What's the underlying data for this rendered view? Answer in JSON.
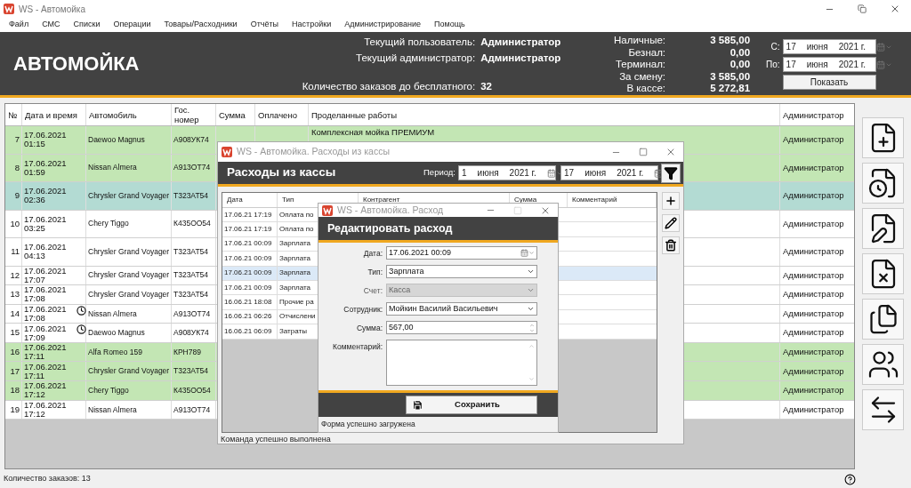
{
  "window": {
    "title": "WS - Автомойка"
  },
  "menu": [
    "Файл",
    "СМС",
    "Списки",
    "Операции",
    "Товары/Расходники",
    "Отчёты",
    "Настройки",
    "Администрирование",
    "Помощь"
  ],
  "header": {
    "title": "АВТОМОЙКА",
    "info": [
      {
        "label": "Текущий пользователь:",
        "value": "Администратор"
      },
      {
        "label": "Текущий администратор:",
        "value": "Администратор"
      },
      {
        "label": "Количество заказов до бесплатного:",
        "value": "32"
      }
    ],
    "totals": [
      {
        "label": "Наличные:",
        "value": "3 585,00"
      },
      {
        "label": "Безнал:",
        "value": "0,00"
      },
      {
        "label": "Терминал:",
        "value": "0,00"
      },
      {
        "label": "За смену:",
        "value": "3 585,00"
      },
      {
        "label": "В кассе:",
        "value": "5 272,81"
      }
    ],
    "date_from": {
      "label": "С:",
      "day": "17",
      "month": "июня",
      "year": "2021 г."
    },
    "date_to": {
      "label": "По:",
      "day": "17",
      "month": "июня",
      "year": "2021 г."
    },
    "show_button": "Показать"
  },
  "orders_table": {
    "columns": [
      "№",
      "Дата и время",
      "Автомобиль",
      "Гос. номер",
      "Сумма",
      "Оплачено",
      "Проделанные работы",
      "Администратор"
    ],
    "rows": [
      {
        "num": "7",
        "date": "17.06.2021",
        "time": "01:15",
        "car": "Daewoo Magnus",
        "plate": "А908УК74",
        "works": "Комплексная мойка ПРЕМИУМ",
        "admin": "Администратор",
        "color": "#c3e6b4",
        "clock": false
      },
      {
        "num": "8",
        "date": "17.06.2021",
        "time": "01:59",
        "car": "Nissan Almera",
        "plate": "А913ОТ74",
        "admin": "Администратор",
        "color": "#c3e6b4",
        "clock": false
      },
      {
        "num": "9",
        "date": "17.06.2021",
        "time": "02:36",
        "car": "Chrysler Grand Voyager",
        "plate": "Т323АТ54",
        "admin": "Администратор",
        "color": "#b3dbd3",
        "clock": false
      },
      {
        "num": "10",
        "date": "17.06.2021",
        "time": "03:25",
        "car": "Chery Tiggo",
        "plate": "К435ОО54",
        "admin": "Администратор",
        "color": "#ffffff",
        "clock": false
      },
      {
        "num": "11",
        "date": "17.06.2021",
        "time": "04:13",
        "car": "Chrysler Grand Voyager",
        "plate": "Т323АТ54",
        "admin": "Администратор",
        "color": "#ffffff",
        "clock": false
      },
      {
        "num": "12",
        "date": "17.06.2021",
        "time": "17:07",
        "car": "Chrysler Grand Voyager",
        "plate": "Т323АТ54",
        "admin": "Администратор",
        "color": "#ffffff",
        "clock": false
      },
      {
        "num": "13",
        "date": "17.06.2021",
        "time": "17:08",
        "car": "Chrysler Grand Voyager",
        "plate": "Т323АТ54",
        "admin": "Администратор",
        "color": "#ffffff",
        "clock": false
      },
      {
        "num": "14",
        "date": "17.06.2021",
        "time": "17:08",
        "car": "Nissan Almera",
        "plate": "А913ОТ74",
        "admin": "Администратор",
        "color": "#ffffff",
        "clock": true
      },
      {
        "num": "15",
        "date": "17.06.2021",
        "time": "17:09",
        "car": "Daewoo Magnus",
        "plate": "А908УК74",
        "admin": "Администратор",
        "color": "#ffffff",
        "clock": true
      },
      {
        "num": "16",
        "date": "17.06.2021",
        "time": "17:11",
        "car": "Alfa Romeo 159",
        "plate": "КРН789",
        "admin": "Администратор",
        "color": "#c3e6b4",
        "clock": false
      },
      {
        "num": "17",
        "date": "17.06.2021",
        "time": "17:11",
        "car": "Chrysler Grand Voyager",
        "plate": "Т323АТ54",
        "admin": "Администратор",
        "color": "#c3e6b4",
        "clock": false
      },
      {
        "num": "18",
        "date": "17.06.2021",
        "time": "17:12",
        "car": "Chery Tiggo",
        "plate": "К435ОО54",
        "admin": "Администратор",
        "color": "#c3e6b4",
        "clock": false
      },
      {
        "num": "19",
        "date": "17.06.2021",
        "time": "17:12",
        "car": "Nissan Almera",
        "plate": "А913ОТ74",
        "admin": "Администратор",
        "color": "#ffffff",
        "clock": false
      }
    ]
  },
  "status_bar": "Количество заказов: 13",
  "expenses_window": {
    "title": "WS - Автомойка. Расходы из кассы",
    "heading": "Расходы из кассы",
    "period_label": "Период:",
    "date_from": {
      "day": "1",
      "month": "июня",
      "year": "2021 г."
    },
    "date_to": {
      "day": "17",
      "month": "июня",
      "year": "2021 г."
    },
    "columns": [
      "Дата",
      "Тип",
      "Контрагент",
      "Сумма",
      "Комментарий"
    ],
    "rows": [
      {
        "date": "17.06.21 17:19",
        "type": "Оплата по",
        "selected": false
      },
      {
        "date": "17.06.21 17:19",
        "type": "Оплата по",
        "selected": false
      },
      {
        "date": "17.06.21 00:09",
        "type": "Зарплата",
        "selected": false
      },
      {
        "date": "17.06.21 00:09",
        "type": "Зарплата",
        "selected": false
      },
      {
        "date": "17.06.21 00:09",
        "type": "Зарплата",
        "selected": true
      },
      {
        "date": "17.06.21 00:09",
        "type": "Зарплата",
        "selected": false
      },
      {
        "date": "16.06.21 18:08",
        "type": "Прочие ра",
        "selected": false
      },
      {
        "date": "16.06.21 06:26",
        "type": "Отчислени",
        "selected": false
      },
      {
        "date": "16.06.21 06:09",
        "type": "Затраты",
        "selected": false
      }
    ],
    "status": "Команда успешно выполнена"
  },
  "edit_window": {
    "title": "WS - Автомойка. Расход",
    "heading": "Редактировать расход",
    "fields": [
      {
        "kind": "date",
        "label": "Дата:",
        "value": "17.06.2021 00:09",
        "disabled": false
      },
      {
        "kind": "select",
        "label": "Тип:",
        "value": "Зарплата",
        "disabled": false
      },
      {
        "kind": "select",
        "label": "Счет:",
        "value": "Касса",
        "disabled": true
      },
      {
        "kind": "select",
        "label": "Сотрудник:",
        "value": "Мойкин Василий Васильевич",
        "disabled": false
      },
      {
        "kind": "number",
        "label": "Сумма:",
        "value": "567,00",
        "disabled": false
      },
      {
        "kind": "textarea",
        "label": "Комментарий:",
        "disabled": false
      }
    ],
    "save_button": "Сохранить",
    "status": "Форма успешно загружена"
  }
}
